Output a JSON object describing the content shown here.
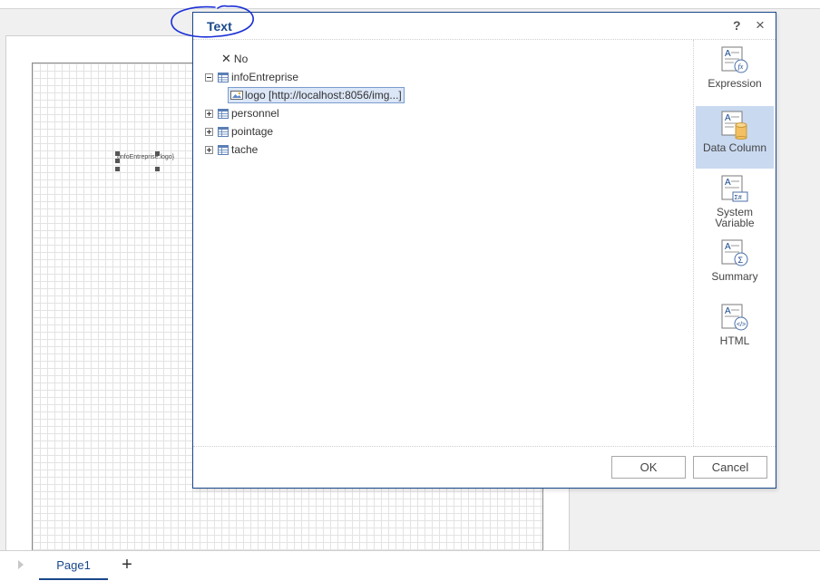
{
  "report": {
    "component_text": "{infoEntreprise.logo}"
  },
  "bottom_bar": {
    "page_tab": "Page1",
    "add_label": "+"
  },
  "dialog": {
    "title": "Text",
    "help": "?",
    "close": "×",
    "tree": {
      "no_item": "No",
      "nodes": [
        {
          "label": "infoEntreprise",
          "expanded": true,
          "children": [
            {
              "label": "logo [http://localhost:8056/img...]"
            }
          ]
        },
        {
          "label": "personnel",
          "expanded": false
        },
        {
          "label": "pointage",
          "expanded": false
        },
        {
          "label": "tache",
          "expanded": false
        }
      ]
    },
    "sidebar": {
      "items": [
        {
          "label": "Expression",
          "icon": "expression-icon"
        },
        {
          "label": "Data Column",
          "icon": "data-column-icon",
          "active": true
        },
        {
          "label": "System Variable",
          "icon": "system-variable-icon"
        },
        {
          "label": "Summary",
          "icon": "summary-icon"
        },
        {
          "label": "HTML",
          "icon": "html-icon"
        }
      ]
    },
    "buttons": {
      "ok": "OK",
      "cancel": "Cancel"
    },
    "colors": {
      "accent": "#19478a",
      "active_bg": "#c9d9f0",
      "annotation": "#1a2fd6"
    }
  }
}
